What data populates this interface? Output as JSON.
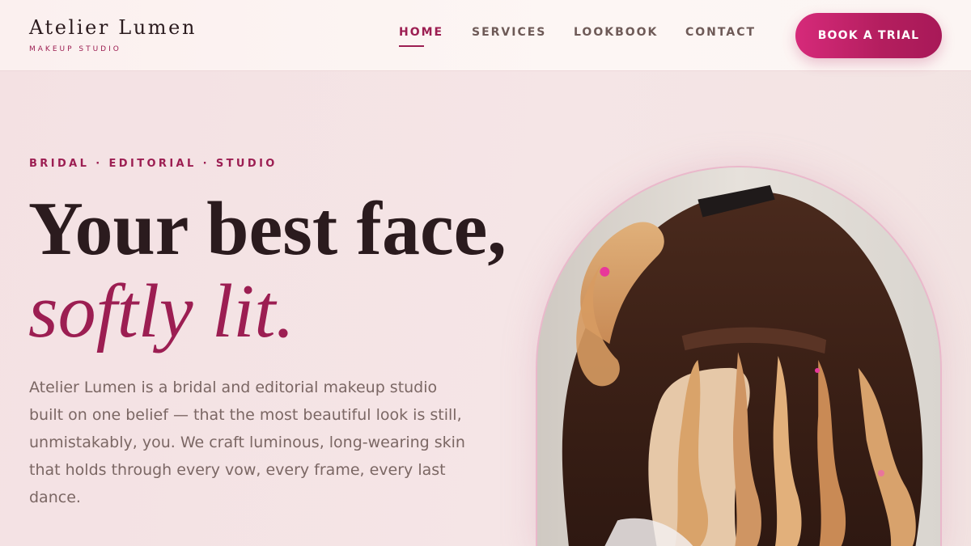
{
  "brand": {
    "name": "Atelier Lumen",
    "tagline": "MAKEUP STUDIO"
  },
  "nav": {
    "items": [
      {
        "label": "HOME",
        "active": true
      },
      {
        "label": "SERVICES",
        "active": false
      },
      {
        "label": "LOOKBOOK",
        "active": false
      },
      {
        "label": "CONTACT",
        "active": false
      }
    ],
    "cta_label": "BOOK A TRIAL"
  },
  "hero": {
    "eyebrow": "BRIDAL · EDITORIAL · STUDIO",
    "headline_line1": "Your best face,",
    "headline_line2": "softly lit.",
    "lead": "Atelier Lumen is a bridal and editorial makeup studio built on one belief — that the most beautiful look is still, unmistakably, you. We craft luminous, long-wearing skin that holds through every vow, every frame, every last dance."
  },
  "colors": {
    "accent": "#9c1e52",
    "cta_gradient_start": "#d62a7a",
    "cta_gradient_end": "#a81958",
    "background": "#f4e1e3",
    "text_dark": "#2b1b1e",
    "text_muted": "#7b6764"
  },
  "icons": [
    "sparkle-dot"
  ]
}
